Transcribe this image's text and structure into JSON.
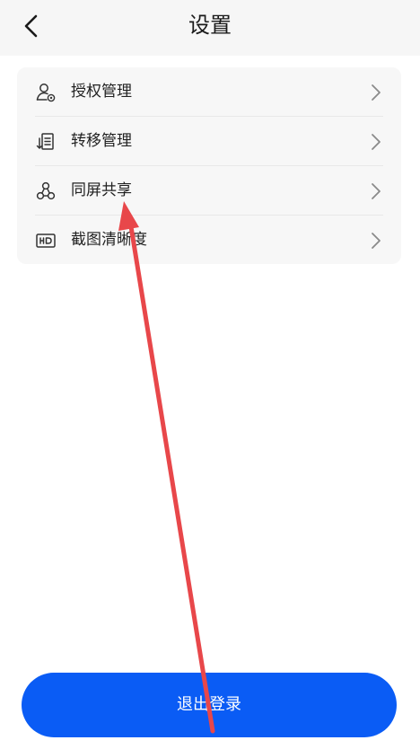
{
  "header": {
    "title": "设置",
    "back_icon": "chevron-left-icon"
  },
  "menu": {
    "items": [
      {
        "label": "授权管理",
        "icon": "user-auth-icon"
      },
      {
        "label": "转移管理",
        "icon": "transfer-icon"
      },
      {
        "label": "同屏共享",
        "icon": "share-circles-icon"
      },
      {
        "label": "截图清晰度",
        "icon": "hd-icon"
      }
    ],
    "chevron_icon": "chevron-right-icon"
  },
  "logout": {
    "label": "退出登录"
  },
  "colors": {
    "accent": "#0a5cf5",
    "header_bg": "#f6f6f6",
    "card_bg": "#f7f7f7",
    "annotation_arrow": "#e8474a"
  }
}
